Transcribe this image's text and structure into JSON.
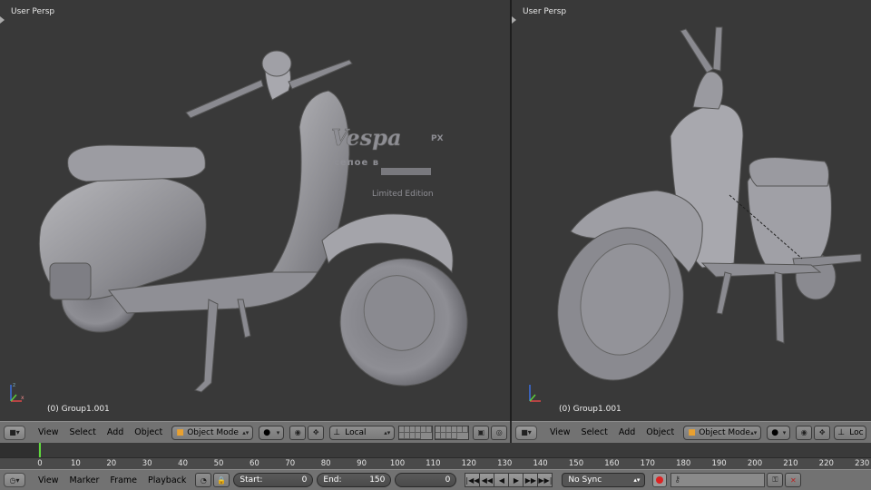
{
  "viewport_left": {
    "title": "User Persp",
    "footer": "(0) Group1.001"
  },
  "viewport_right": {
    "title": "User Persp",
    "footer": "(0) Group1.001"
  },
  "model_text": {
    "brand": "Vespa",
    "suffix": "PX",
    "line2": "сепое в",
    "edition": "Limited Edition"
  },
  "header_left": {
    "menu": [
      "View",
      "Select",
      "Add",
      "Object"
    ],
    "mode": "Object Mode",
    "orientation": "Local"
  },
  "header_right": {
    "menu": [
      "View",
      "Select",
      "Add",
      "Object"
    ],
    "mode": "Object Mode",
    "orientation": "Loc"
  },
  "timeline": {
    "ticks": [
      0,
      10,
      20,
      30,
      40,
      50,
      60,
      70,
      80,
      90,
      100,
      110,
      120,
      130,
      140,
      150,
      160,
      170,
      180,
      190,
      200,
      210,
      220,
      230
    ],
    "current_frame": 0
  },
  "footer": {
    "menu": [
      "View",
      "Marker",
      "Frame",
      "Playback"
    ],
    "start_label": "Start:",
    "start_value": "0",
    "end_label": "End:",
    "end_value": "150",
    "current_value": "0",
    "sync": "No Sync"
  },
  "colors": {
    "viewport_bg": "#393939",
    "header_bg": "#727272",
    "playhead": "#5fd93c",
    "record": "#dd2222"
  }
}
